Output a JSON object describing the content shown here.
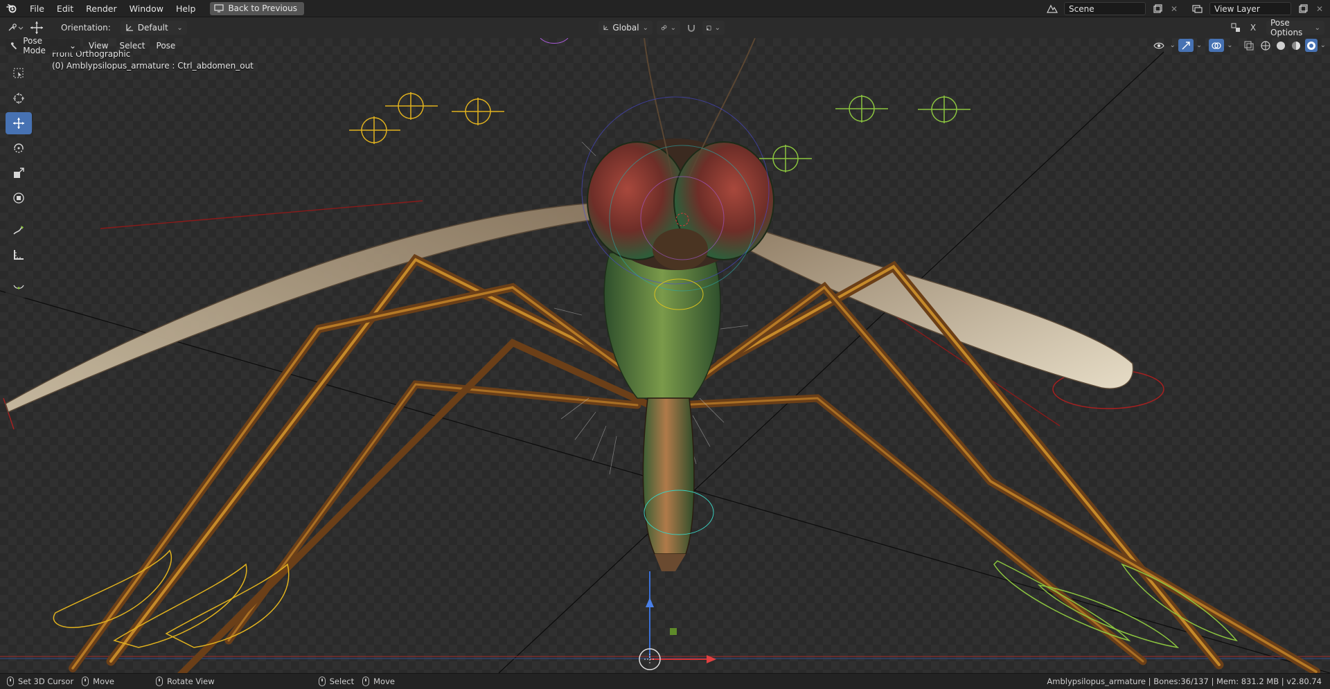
{
  "menubar": {
    "items": [
      "File",
      "Edit",
      "Render",
      "Window",
      "Help"
    ],
    "back_button": "Back to Previous",
    "scene": "Scene",
    "view_layer": "View Layer"
  },
  "viewport_header": {
    "orientation_label": "Orientation:",
    "orientation_value": "Default",
    "transform_space": "Global",
    "mode": "Pose Mode",
    "menus": [
      "View",
      "Select",
      "Pose"
    ],
    "pose_options": "Pose Options"
  },
  "viewport": {
    "view_name": "Front Orthographic",
    "active_object": "(0) Amblypsilopus_armature : Ctrl_abdomen_out"
  },
  "toolbar": {
    "tools": [
      "select-box-icon",
      "cursor-icon",
      "move-icon",
      "rotate-icon",
      "scale-icon",
      "transform-icon",
      "annotate-icon",
      "measure-icon",
      "bone-roll-icon"
    ],
    "active": "move-icon"
  },
  "statusbar": {
    "left": [
      "Set 3D Cursor",
      "Move",
      "Rotate View",
      "Select",
      "Move"
    ],
    "right": "Amblypsilopus_armature | Bones:36/137 | Mem: 831.2 MB | v2.80.74"
  },
  "colors": {
    "accent": "#4772b3",
    "bone_yellow": "#e1b21e",
    "bone_green": "#8cc63f",
    "axis_red": "#d03232",
    "axis_blue": "#3b6fd4"
  }
}
